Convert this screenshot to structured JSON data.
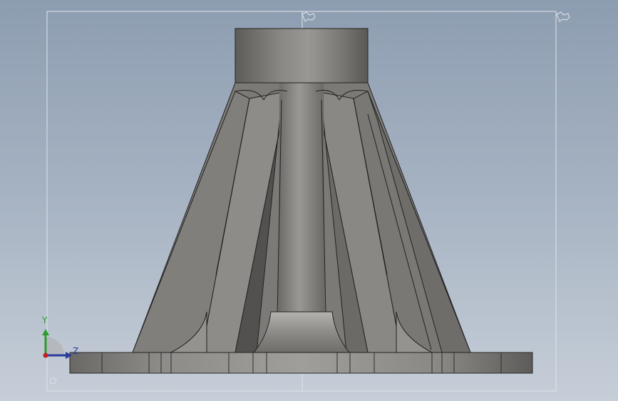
{
  "viewport": {
    "background_top": "#8d9db1",
    "background_bottom": "#c6ced8"
  },
  "triad": {
    "axis_y_label": "Y",
    "axis_z_label": "Z",
    "y_color": "#2c9a2c",
    "z_color": "#2a3a9e",
    "x_color": "#c02020"
  },
  "icons": {
    "top_center_marker": "sketch-origin-icon",
    "top_right_marker": "sketch-origin-icon",
    "bottom_left_marker": "sketch-origin-icon"
  },
  "model": {
    "face_color": "#8c8a86",
    "edge_color": "#222222"
  }
}
